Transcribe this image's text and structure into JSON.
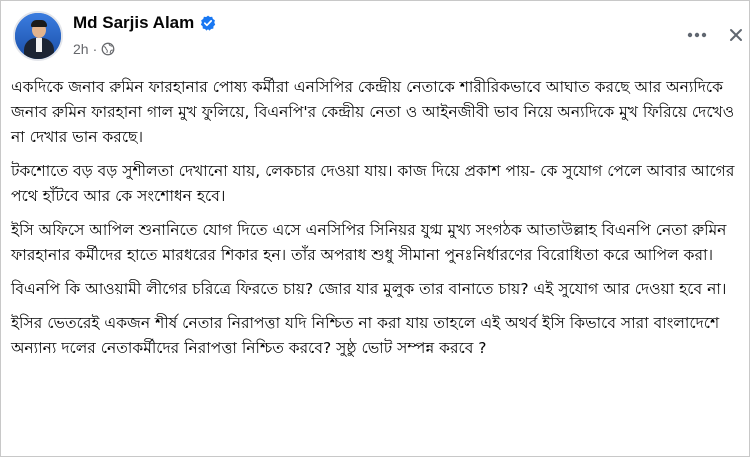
{
  "post": {
    "author_name": "Md Sarjis Alam",
    "timestamp": "2h",
    "separator": "·",
    "privacy_icon": "globe-icon",
    "verified_icon": "verified-badge-icon",
    "verified_color": "#1877f2",
    "more_icon": "more-dots-icon",
    "close_icon": "close-icon",
    "paragraphs": [
      "একদিকে জনাব রুমিন ফারহানার পোষ্য কর্মীরা এনসিপির কেন্দ্রীয় নেতাকে শারীরিকভাবে আঘাত করছে আর অন্যদিকে জনাব রুমিন ফারহানা গাল মুখ ফুলিয়ে, বিএনপি'র কেন্দ্রীয় নেতা ও আইনজীবী ভাব নিয়ে অন্যদিকে মুখ ফিরিয়ে দেখেও না দেখার ভান করছে।",
      "টকশোতে বড় বড় সুশীলতা দেখানো যায়, লেকচার দেওয়া যায়। কাজ দিয়ে প্রকাশ পায়- কে সুযোগ পেলে আবার আগের পথে হাঁটবে আর কে সংশোধন হবে।",
      "ইসি অফিসে আপিল শুনানিতে যোগ দিতে এসে এনসিপির সিনিয়র যুগ্ম মুখ্য সংগঠক আতাউল্লাহ বিএনপি নেতা রুমিন ফারহানার কর্মীদের হাতে মারধরের শিকার হন। তাঁর অপরাধ শুধু সীমানা পুনঃনির্ধারণের বিরোধিতা করে আপিল করা।",
      "বিএনপি কি আওয়ামী লীগের চরিত্রে ফিরতে চায়? জোর যার মুলুক তার বানাতে চায়? এই সুযোগ আর দেওয়া হবে না।",
      "ইসির ভেতরেই একজন শীর্ষ নেতার নিরাপত্তা যদি নিশ্চিত না করা যায় তাহলে এই অথর্ব ইসি কিভাবে সারা বাংলাদেশে অন্যান্য দলের নেতাকর্মীদের নিরাপত্তা নিশ্চিত করবে? সুষ্ঠু ভোট সম্পন্ন করবে ?"
    ]
  }
}
